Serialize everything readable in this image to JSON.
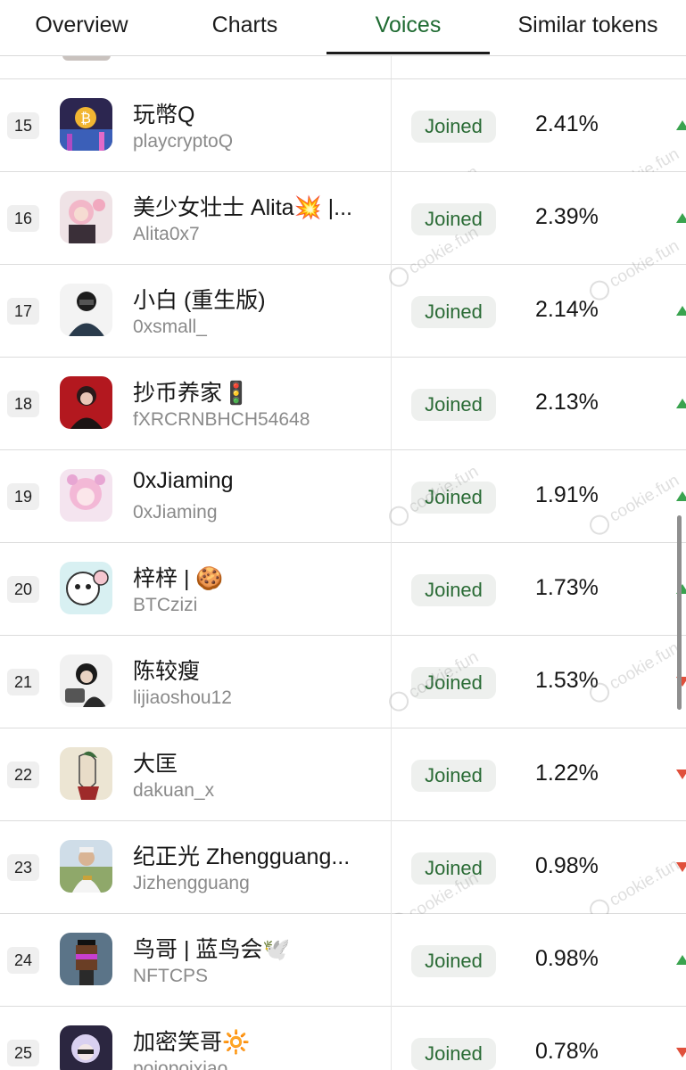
{
  "tabs": [
    {
      "label": "Overview"
    },
    {
      "label": "Charts"
    },
    {
      "label": "Voices"
    },
    {
      "label": "Similar tokens"
    }
  ],
  "watermark": "cookie.fun",
  "rows": [
    {
      "rank": "15",
      "name": "玩幣Q",
      "handle": "playcryptoQ",
      "status": "Joined",
      "share": "2.41%",
      "trend": "up"
    },
    {
      "rank": "16",
      "name": "美少女壮士 Alita💥 |...",
      "handle": "Alita0x7",
      "status": "Joined",
      "share": "2.39%",
      "trend": "up"
    },
    {
      "rank": "17",
      "name": "小白 (重生版)",
      "handle": "0xsmall_",
      "status": "Joined",
      "share": "2.14%",
      "trend": "up"
    },
    {
      "rank": "18",
      "name": "抄币养家🚦",
      "handle": "fXRCRNBHCH54648",
      "status": "Joined",
      "share": "2.13%",
      "trend": "up"
    },
    {
      "rank": "19",
      "name": "0xJiaming",
      "handle": "0xJiaming",
      "status": "Joined",
      "share": "1.91%",
      "trend": "up"
    },
    {
      "rank": "20",
      "name": "梓梓 | 🍪",
      "handle": "BTCzizi",
      "status": "Joined",
      "share": "1.73%",
      "trend": "up"
    },
    {
      "rank": "21",
      "name": "陈较瘦",
      "handle": "lijiaoshou12",
      "status": "Joined",
      "share": "1.53%",
      "trend": "down"
    },
    {
      "rank": "22",
      "name": "大匡",
      "handle": "dakuan_x",
      "status": "Joined",
      "share": "1.22%",
      "trend": "down"
    },
    {
      "rank": "23",
      "name": "纪正光 Zhengguang...",
      "handle": "Jizhengguang",
      "status": "Joined",
      "share": "0.98%",
      "trend": "down"
    },
    {
      "rank": "24",
      "name": "鸟哥 | 蓝鸟会🕊️",
      "handle": "NFTCPS",
      "status": "Joined",
      "share": "0.98%",
      "trend": "up"
    },
    {
      "rank": "25",
      "name": "加密笑哥🔆",
      "handle": "pojopojxiao",
      "status": "Joined",
      "share": "0.78%",
      "trend": "down"
    }
  ],
  "colors": {
    "accent_tab": "#1f6b32",
    "badge_text": "#2a6b35",
    "up": "#3aa34f",
    "down": "#e0503c"
  }
}
